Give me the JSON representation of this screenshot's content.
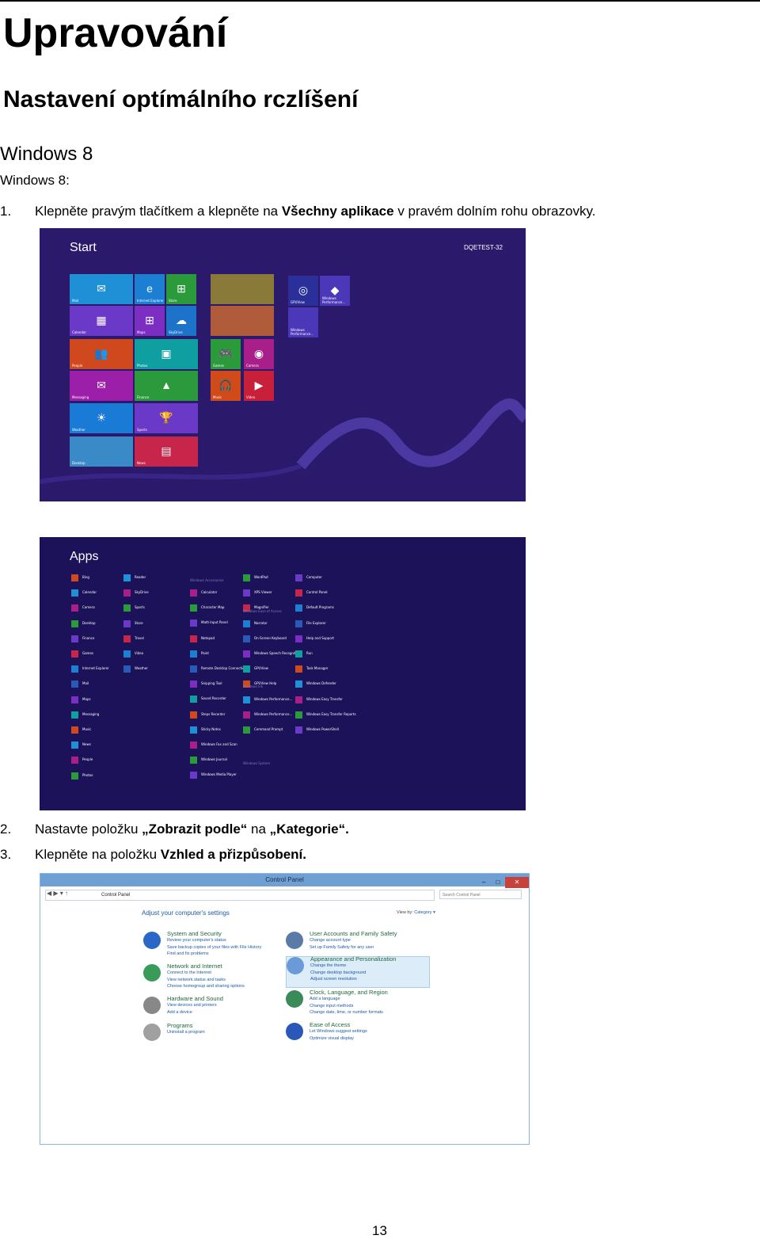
{
  "heading1": "Upravování",
  "heading2": "Nastavení optímálního rczlíšení",
  "heading3": "Windows 8",
  "intro": "Windows 8:",
  "steps": [
    {
      "num": "1.",
      "pre": "Klepněte pravým tlačítkem a klepněte na ",
      "bold": "Všechny aplikace",
      "post": " v pravém dolním rohu obrazovky."
    },
    {
      "num": "2.",
      "pre": "Nastavte položku ",
      "bold": "„Zobrazit podle“",
      "mid": " na ",
      "bold2": "„Kategorie“."
    },
    {
      "num": "3.",
      "pre": "Klepněte na položku ",
      "bold": "Vzhled a přizpůsobení."
    }
  ],
  "start_screen": {
    "title": "Start",
    "user": "DQETEST-32",
    "tiles": [
      {
        "label": "Mail",
        "icon": "✉",
        "color": "#1f8fd6"
      },
      {
        "label": "Internet Explorer",
        "icon": "e",
        "color": "#1c7fd1"
      },
      {
        "label": "Store",
        "icon": "⊞",
        "color": "#2a9a3b"
      },
      {
        "label": "Calendar",
        "icon": "▦",
        "color": "#6b39c8"
      },
      {
        "label": "Maps",
        "icon": "⊞",
        "color": "#7d2ec2"
      },
      {
        "label": "SkyDrive",
        "icon": "☁",
        "color": "#1d73c9"
      },
      {
        "label": "People",
        "icon": "👥",
        "color": "#d0481e"
      },
      {
        "label": "Photos",
        "icon": "▣",
        "color": "#0f9fa0"
      },
      {
        "label": "Messaging",
        "icon": "✉",
        "color": "#9b1fa8"
      },
      {
        "label": "Finance",
        "icon": "▲",
        "color": "#2b9a3d"
      },
      {
        "label": "Weather",
        "icon": "☀",
        "color": "#1a7bd6"
      },
      {
        "label": "Sports",
        "icon": "🏆",
        "color": "#6a39c8"
      },
      {
        "label": "Desktop",
        "icon": "",
        "color": "#3a8ac8"
      },
      {
        "label": "News",
        "icon": "▤",
        "color": "#c8254a"
      },
      {
        "label": "",
        "icon": "",
        "color": "#8a7a3a"
      },
      {
        "label": "",
        "icon": "",
        "color": "#b05b3a"
      },
      {
        "label": "Games",
        "icon": "🎮",
        "color": "#2a9a3b"
      },
      {
        "label": "Camera",
        "icon": "◉",
        "color": "#a81f8a"
      },
      {
        "label": "Music",
        "icon": "🎧",
        "color": "#d04a1a"
      },
      {
        "label": "Video",
        "icon": "▶",
        "color": "#c81f3a"
      },
      {
        "label": "GPUView",
        "icon": "◎",
        "color": "#2a2f9a"
      },
      {
        "label": "Windows Performance...",
        "icon": "◆",
        "color": "#4a38b8"
      },
      {
        "label": "Windows Performance...",
        "icon": "",
        "color": "#4a38b8"
      }
    ]
  },
  "apps_screen": {
    "title": "Apps",
    "groups": [
      "Windows Accessories",
      "Windows Ease of Access",
      "Windows Ink",
      "Windows System"
    ],
    "col1": [
      "Bing",
      "Calendar",
      "Camera",
      "Desktop",
      "Finance",
      "Games",
      "Internet Explorer",
      "Mail",
      "Maps",
      "Messaging",
      "Music",
      "News",
      "People",
      "Photos"
    ],
    "col2": [
      "Reader",
      "SkyDrive",
      "Sports",
      "Store",
      "Travel",
      "Video",
      "Weather"
    ],
    "col3": [
      "Calculator",
      "Character Map",
      "Math Input Panel",
      "Notepad",
      "Paint",
      "Remote Desktop Connection",
      "Snipping Tool",
      "Sound Recorder",
      "Steps Recorder",
      "Sticky Notes",
      "Windows Fax and Scan",
      "Windows Journal",
      "Windows Media Player"
    ],
    "col4": [
      "WordPad",
      "XPS Viewer",
      "Magnifier",
      "Narrator",
      "On-Screen Keyboard",
      "Windows Speech Recognition",
      "GPUView",
      "GPUView Help",
      "Windows Performance...",
      "Windows Performance...",
      "Command Prompt"
    ],
    "col5": [
      "Computer",
      "Control Panel",
      "Default Programs",
      "File Explorer",
      "Help and Support",
      "Run",
      "Task Manager",
      "Windows Defender",
      "Windows Easy Transfer",
      "Windows Easy Transfer Reports",
      "Windows PowerShell"
    ]
  },
  "control_panel": {
    "window_title": "Control Panel",
    "address": "Control Panel",
    "search_placeholder": "Search Control Panel",
    "heading": "Adjust your computer's settings",
    "view_by_label": "View by:",
    "view_by_value": "Category ▾",
    "left": [
      {
        "title": "System and Security",
        "links": [
          "Review your computer's status",
          "Save backup copies of your files with File History",
          "Find and fix problems"
        ],
        "color": "#2a68c8"
      },
      {
        "title": "Network and Internet",
        "links": [
          "Connect to the Internet",
          "View network status and tasks",
          "Choose homegroup and sharing options"
        ],
        "color": "#3a9a5a"
      },
      {
        "title": "Hardware and Sound",
        "links": [
          "View devices and printers",
          "Add a device"
        ],
        "color": "#888888"
      },
      {
        "title": "Programs",
        "links": [
          "Uninstall a program"
        ],
        "color": "#a0a0a0"
      }
    ],
    "right": [
      {
        "title": "User Accounts and Family Safety",
        "links": [
          "Change account type",
          "Set up Family Safety for any user"
        ],
        "color": "#5a7aa8"
      },
      {
        "title": "Appearance and Personalization",
        "links": [
          "Change the theme",
          "Change desktop background",
          "Adjust screen resolution"
        ],
        "color": "#6a9ad8"
      },
      {
        "title": "Clock, Language, and Region",
        "links": [
          "Add a language",
          "Change input methods",
          "Change date, time, or number formats"
        ],
        "color": "#3a8a5a"
      },
      {
        "title": "Ease of Access",
        "links": [
          "Let Windows suggest settings",
          "Optimize visual display"
        ],
        "color": "#2a58b8"
      }
    ]
  },
  "page_number": "13"
}
